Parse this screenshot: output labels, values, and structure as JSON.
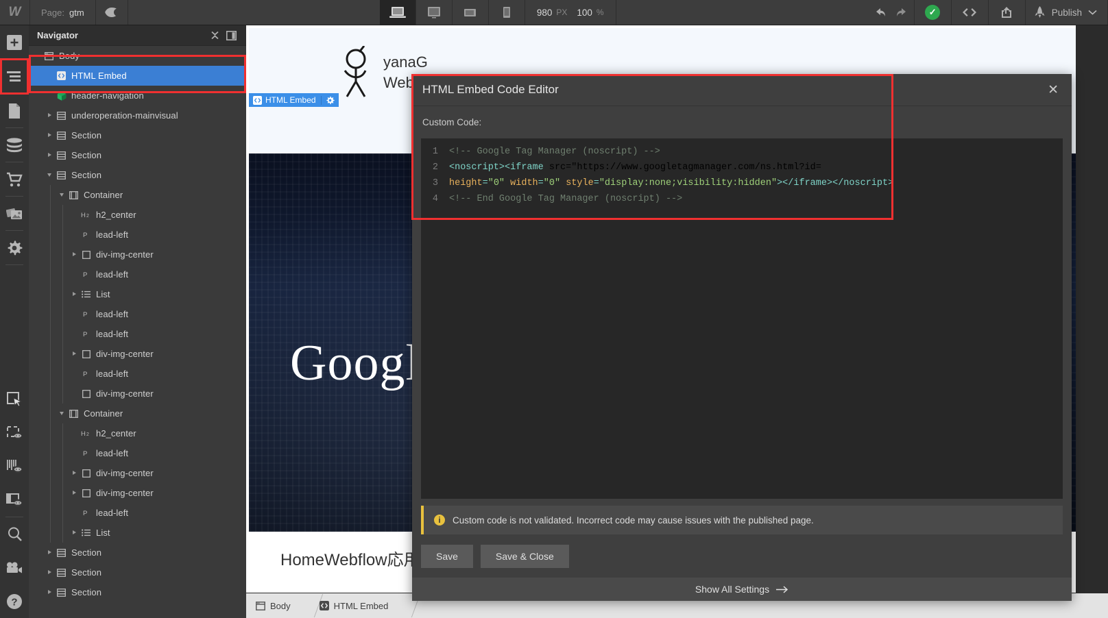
{
  "topbar": {
    "logo": "W",
    "page_label": "Page:",
    "page_name": "gtm",
    "eye_icon": "eye-icon",
    "devices": [
      {
        "name": "desktop",
        "icon": "laptop-icon",
        "active": true
      },
      {
        "name": "tablet-landscape",
        "icon": "monitor-icon",
        "active": false
      },
      {
        "name": "tablet",
        "icon": "tablet-landscape-icon",
        "active": false
      },
      {
        "name": "mobile",
        "icon": "phone-icon",
        "active": false
      }
    ],
    "viewport_width": "980",
    "viewport_unit": "PX",
    "zoom_value": "100",
    "zoom_unit": "%",
    "undo_icon": "undo-arrow-icon",
    "redo_icon": "redo-arrow-icon",
    "status_icon": "checkmark-circle-icon",
    "code_icon": "code-brackets-icon",
    "share_icon": "share-export-icon",
    "rocket_icon": "rocket-icon",
    "publish_label": "Publish",
    "publish_caret": "chevron-down-icon"
  },
  "rail": {
    "items": [
      {
        "name": "add-elements",
        "icon": "plus-icon"
      },
      {
        "name": "navigator",
        "icon": "navigator-layers-icon"
      },
      {
        "name": "pages",
        "icon": "page-document-icon"
      },
      {
        "name": "cms",
        "icon": "database-icon"
      },
      {
        "name": "ecommerce",
        "icon": "shopping-cart-icon"
      },
      {
        "name": "assets",
        "icon": "images-icon"
      },
      {
        "name": "settings",
        "icon": "gear-icon"
      }
    ],
    "items_bottom": [
      {
        "name": "style-selector",
        "icon": "cursor-select-icon"
      },
      {
        "name": "style-manager",
        "icon": "marquee-eye-icon"
      },
      {
        "name": "interactions",
        "icon": "bars-eye-icon"
      },
      {
        "name": "audit",
        "icon": "panel-eye-icon"
      },
      {
        "name": "search",
        "icon": "search-magnifier-icon"
      },
      {
        "name": "video-tutorials",
        "icon": "video-camera-icon"
      },
      {
        "name": "help",
        "icon": "question-circle-icon"
      }
    ]
  },
  "navigator": {
    "title": "Navigator",
    "collapse_icon": "collapse-all-icon",
    "panel_icon": "panel-toggle-icon",
    "tree": [
      {
        "label": "Body",
        "icon": "body-icon",
        "depth": 0,
        "arrow": "none",
        "selected": false
      },
      {
        "label": "HTML Embed",
        "icon": "embed-icon",
        "depth": 1,
        "arrow": "none",
        "selected": true
      },
      {
        "label": "header-navigation",
        "icon": "symbol-icon",
        "depth": 1,
        "arrow": "none",
        "selected": false
      },
      {
        "label": "underoperation-mainvisual",
        "icon": "section-icon",
        "depth": 1,
        "arrow": "closed",
        "selected": false
      },
      {
        "label": "Section",
        "icon": "section-icon",
        "depth": 1,
        "arrow": "closed",
        "selected": false
      },
      {
        "label": "Section",
        "icon": "section-icon",
        "depth": 1,
        "arrow": "closed",
        "selected": false
      },
      {
        "label": "Section",
        "icon": "section-icon",
        "depth": 1,
        "arrow": "open",
        "selected": false
      },
      {
        "label": "Container",
        "icon": "container-icon",
        "depth": 2,
        "arrow": "open",
        "selected": false
      },
      {
        "label": "h2_center",
        "icon": "h2-icon",
        "depth": 3,
        "arrow": "none",
        "selected": false
      },
      {
        "label": "lead-left",
        "icon": "p-icon",
        "depth": 3,
        "arrow": "none",
        "selected": false
      },
      {
        "label": "div-img-center",
        "icon": "div-icon",
        "depth": 3,
        "arrow": "closed",
        "selected": false
      },
      {
        "label": "lead-left",
        "icon": "p-icon",
        "depth": 3,
        "arrow": "none",
        "selected": false
      },
      {
        "label": "List",
        "icon": "list-icon",
        "depth": 3,
        "arrow": "closed",
        "selected": false
      },
      {
        "label": "lead-left",
        "icon": "p-icon",
        "depth": 3,
        "arrow": "none",
        "selected": false
      },
      {
        "label": "lead-left",
        "icon": "p-icon",
        "depth": 3,
        "arrow": "none",
        "selected": false
      },
      {
        "label": "div-img-center",
        "icon": "div-icon",
        "depth": 3,
        "arrow": "closed",
        "selected": false
      },
      {
        "label": "lead-left",
        "icon": "p-icon",
        "depth": 3,
        "arrow": "none",
        "selected": false
      },
      {
        "label": "div-img-center",
        "icon": "div-icon",
        "depth": 3,
        "arrow": "none",
        "selected": false
      },
      {
        "label": "Container",
        "icon": "container-icon",
        "depth": 2,
        "arrow": "open",
        "selected": false
      },
      {
        "label": "h2_center",
        "icon": "h2-icon",
        "depth": 3,
        "arrow": "none",
        "selected": false
      },
      {
        "label": "lead-left",
        "icon": "p-icon",
        "depth": 3,
        "arrow": "none",
        "selected": false
      },
      {
        "label": "div-img-center",
        "icon": "div-icon",
        "depth": 3,
        "arrow": "closed",
        "selected": false
      },
      {
        "label": "div-img-center",
        "icon": "div-icon",
        "depth": 3,
        "arrow": "closed",
        "selected": false
      },
      {
        "label": "lead-left",
        "icon": "p-icon",
        "depth": 3,
        "arrow": "none",
        "selected": false
      },
      {
        "label": "List",
        "icon": "list-icon",
        "depth": 3,
        "arrow": "closed",
        "selected": false
      },
      {
        "label": "Section",
        "icon": "section-icon",
        "depth": 1,
        "arrow": "closed",
        "selected": false
      },
      {
        "label": "Section",
        "icon": "section-icon",
        "depth": 1,
        "arrow": "closed",
        "selected": false
      },
      {
        "label": "Section",
        "icon": "section-icon",
        "depth": 1,
        "arrow": "closed",
        "selected": false
      }
    ]
  },
  "canvas": {
    "element_badge": {
      "label": "HTML Embed",
      "icon": "embed-icon",
      "gear_icon": "gear-icon"
    },
    "site_logo_line1": "yanaG",
    "site_logo_line2": "Webflow",
    "hero_text": "Google",
    "footer_text": "HomeWebflow応用Go",
    "breadcrumb": [
      {
        "label": "Body",
        "icon": "body-icon"
      },
      {
        "label": "HTML Embed",
        "icon": "embed-icon"
      }
    ]
  },
  "modal": {
    "title": "HTML Embed Code Editor",
    "close_icon": "close-x-icon",
    "custom_code_label": "Custom Code:",
    "code_lines": [
      {
        "num": "1",
        "text": "<!-- Google Tag Manager (noscript) -->"
      },
      {
        "num": "2",
        "text": "<noscript><iframe src=\"https://www.googletagmanager.com/ns.html?id="
      },
      {
        "num": "3",
        "text": "height=\"0\" width=\"0\" style=\"display:none;visibility:hidden\"></iframe></noscript>"
      },
      {
        "num": "4",
        "text": "<!-- End Google Tag Manager (noscript) -->"
      }
    ],
    "warning_icon": "info-icon",
    "warning_text": "Custom code is not validated. Incorrect code may cause issues with the published page.",
    "save_label": "Save",
    "save_close_label": "Save & Close",
    "show_all_settings_label": "Show All Settings",
    "show_all_settings_arrow": "arrow-right-icon"
  },
  "colors": {
    "accent_blue": "#3b7fd4",
    "annotation_red": "#f03030",
    "status_green": "#2ea84f",
    "warning_yellow": "#e8c13e"
  }
}
